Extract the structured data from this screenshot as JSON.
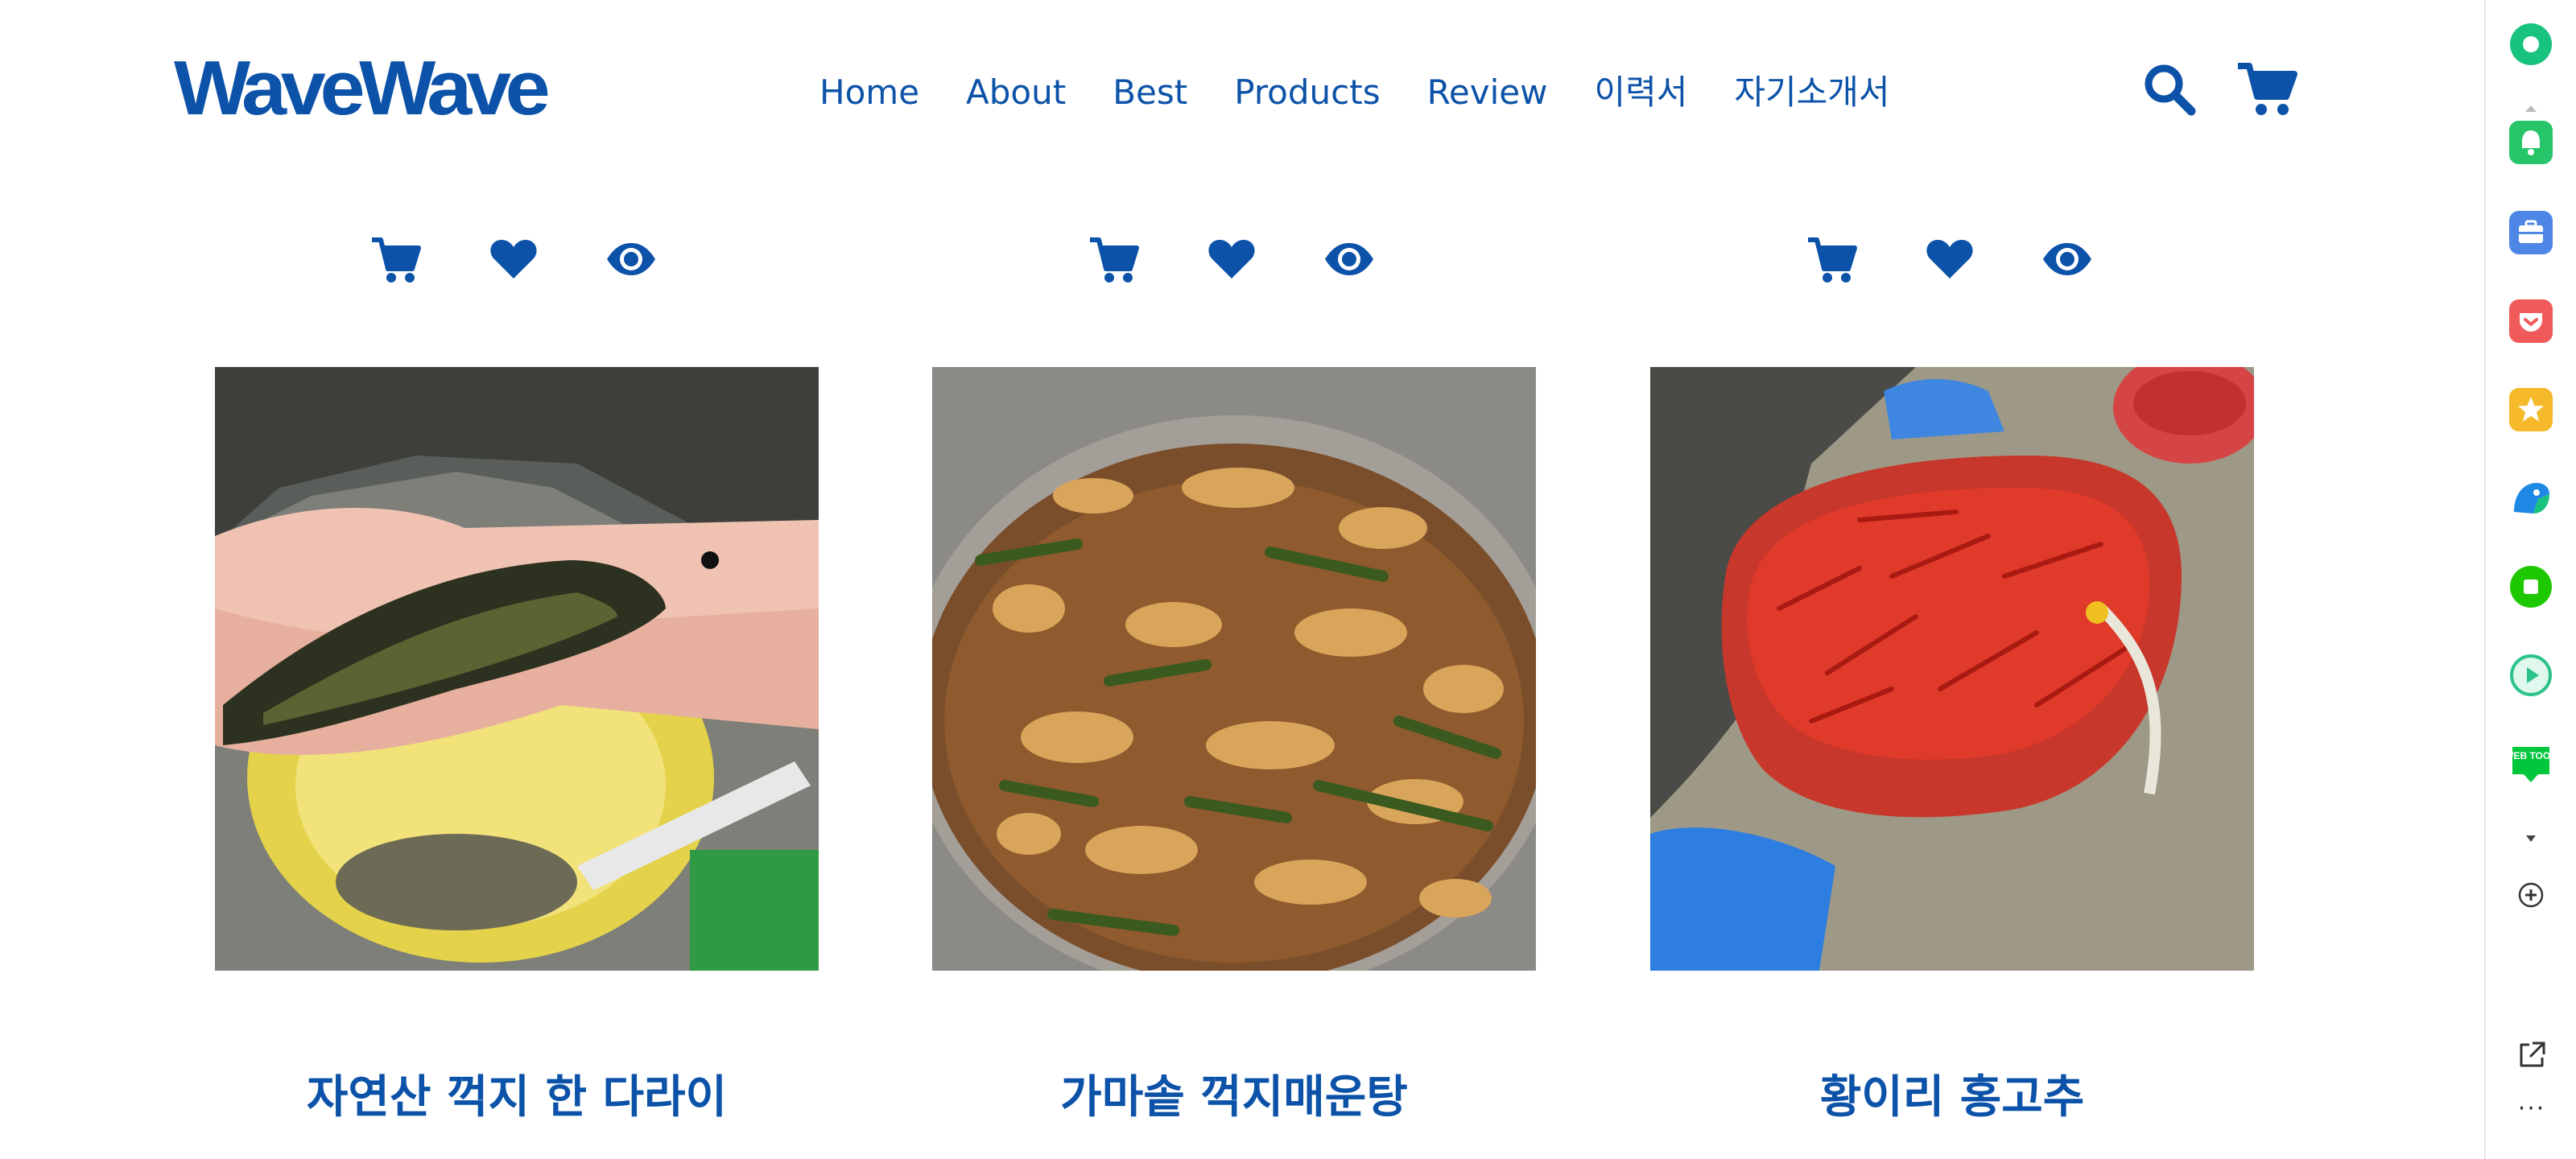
{
  "header": {
    "logo": "WaveWave",
    "nav": [
      "Home",
      "About",
      "Best",
      "Products",
      "Review",
      "이력서",
      "자기소개서"
    ],
    "icons": [
      "search-icon",
      "cart-icon"
    ]
  },
  "products": [
    {
      "title": "자연산 꺽지 한 다라이",
      "actions": [
        "cart-icon",
        "heart-icon",
        "eye-icon"
      ]
    },
    {
      "title": "가마솥 꺽지매운탕",
      "actions": [
        "cart-icon",
        "heart-icon",
        "eye-icon"
      ]
    },
    {
      "title": "황이리 홍고추",
      "actions": [
        "cart-icon",
        "heart-icon",
        "eye-icon"
      ]
    }
  ],
  "sidebar": {
    "icons": [
      "status-icon",
      "notification-icon",
      "briefcase-icon",
      "pocket-icon",
      "star-icon",
      "papago-icon",
      "square-icon",
      "play-icon",
      "webtoon-icon",
      "chevron-down-icon",
      "add-icon",
      "external-link-icon",
      "more-icon"
    ],
    "webtoon_label": "WEB TOON",
    "more_label": "···"
  },
  "colors": {
    "brand": "#0b52a8",
    "background": "#ffffff",
    "naver_green": "#1ec800"
  }
}
